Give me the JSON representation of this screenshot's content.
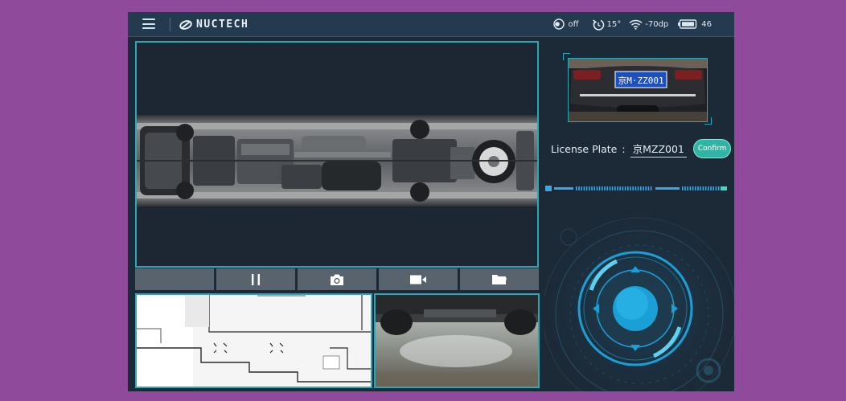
{
  "header": {
    "logo_text": "NUCTECH",
    "status": {
      "toggle_label": "off",
      "tilt": "15°",
      "signal": "-70dp",
      "battery": "46"
    }
  },
  "controls": {
    "items": [
      {
        "icon": "blank"
      },
      {
        "icon": "pause-icon"
      },
      {
        "icon": "camera-icon"
      },
      {
        "icon": "video-icon"
      },
      {
        "icon": "folder-icon"
      }
    ]
  },
  "license": {
    "label": "License Plate",
    "separator": ":",
    "value": "京MZZ001",
    "photo_plate_text": "京M·ZZ001",
    "confirm_label": "Confirm"
  },
  "colors": {
    "background": "#8f4a9b",
    "app_bg": "#1c2937",
    "accent": "#2aa8b8",
    "confirm": "#2fb5a3",
    "joystick": "#1aa0d6"
  }
}
